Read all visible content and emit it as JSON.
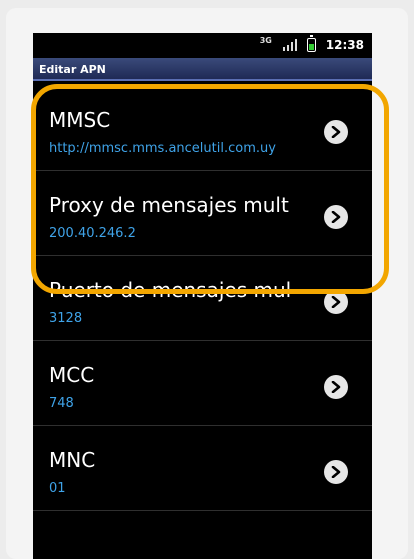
{
  "status": {
    "network": "3G",
    "time": "12:38"
  },
  "titlebar": {
    "title": "Editar APN"
  },
  "list": [
    {
      "title": "MMSC",
      "value": "http://mmsc.mms.ancelutil.com.uy"
    },
    {
      "title": "Proxy de mensajes mult",
      "value": "200.40.246.2"
    },
    {
      "title": "Puerto de mensajes mul",
      "value": "3128"
    },
    {
      "title": "MCC",
      "value": "748"
    },
    {
      "title": "MNC",
      "value": "01"
    }
  ],
  "colors": {
    "highlight": "#f2a600",
    "value_text": "#3fa3e8",
    "title_bar": "#1f2a55"
  }
}
